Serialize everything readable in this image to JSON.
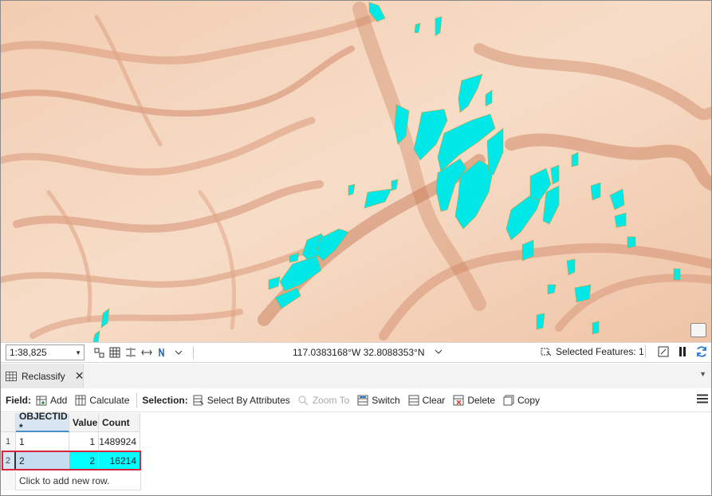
{
  "map": {
    "theme_colors": {
      "terrain_light": "#fbeadb",
      "terrain_mid": "#e9b394",
      "terrain_dark": "#c97a57",
      "highlight": "#00e8e8"
    }
  },
  "status_bar": {
    "scale": "1:38,825",
    "coordinates": "117.0383168°W 32.8088353°N",
    "selected_features": "Selected Features: 1"
  },
  "pane": {
    "tab_label": "Reclassify"
  },
  "toolbar": {
    "field_label": "Field:",
    "add_label": "Add",
    "calculate_label": "Calculate",
    "selection_label": "Selection:",
    "select_by_attributes_label": "Select By Attributes",
    "zoom_to_label": "Zoom To",
    "switch_label": "Switch",
    "clear_label": "Clear",
    "delete_label": "Delete",
    "copy_label": "Copy"
  },
  "table": {
    "columns": [
      "OBJECTID *",
      "Value",
      "Count"
    ],
    "rows": [
      {
        "num": "1",
        "objectid": "1",
        "value": "1",
        "count": "1489924"
      },
      {
        "num": "2",
        "objectid": "2",
        "value": "2",
        "count": "16214"
      }
    ],
    "new_row_hint": "Click to add new row."
  }
}
